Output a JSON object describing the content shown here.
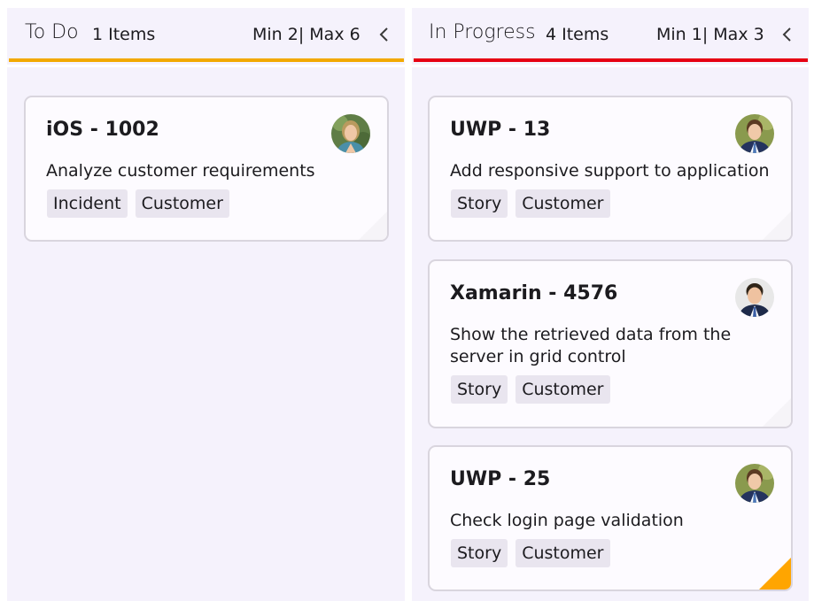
{
  "colors": {
    "todo_bar": "#f2a900",
    "progress_bar": "#e60012",
    "priority_high": "#ffa500",
    "priority_low": "#f6f4f8"
  },
  "columns": [
    {
      "title": "To Do",
      "count": "1 Items",
      "limits": "Min 2| Max 6",
      "collapse_icon": "chevron-left-icon",
      "cards": [
        {
          "title": "iOS - 1002",
          "description": "Analyze customer requirements",
          "tags": [
            "Incident",
            "Customer"
          ],
          "avatar": "avatar-woman"
        }
      ]
    },
    {
      "title": "In Progress",
      "count": "4 Items",
      "limits": "Min 1| Max 3",
      "collapse_icon": "chevron-left-icon",
      "cards": [
        {
          "title": "UWP - 13",
          "description": "Add responsive support to application",
          "tags": [
            "Story",
            "Customer"
          ],
          "avatar": "avatar-man"
        },
        {
          "title": "Xamarin - 4576",
          "description": "Show the retrieved data from the server in grid control",
          "tags": [
            "Story",
            "Customer"
          ],
          "avatar": "avatar-man"
        },
        {
          "title": "UWP - 25",
          "description": "Check login page validation",
          "tags": [
            "Story",
            "Customer"
          ],
          "avatar": "avatar-man"
        }
      ]
    }
  ]
}
